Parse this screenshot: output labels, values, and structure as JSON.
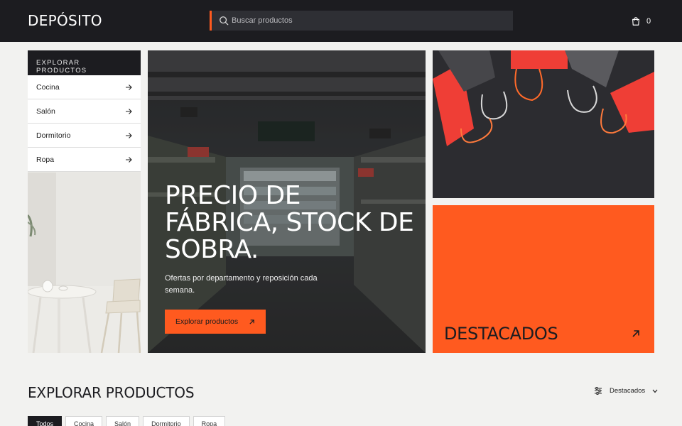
{
  "header": {
    "logo": "DEPÓSITO",
    "search_placeholder": "Buscar productos",
    "cart_count": "0"
  },
  "categories": {
    "title": "EXPLORAR PRODUCTOS",
    "items": [
      {
        "label": "Cocina"
      },
      {
        "label": "Salón"
      },
      {
        "label": "Dormitorio"
      },
      {
        "label": "Ropa"
      }
    ]
  },
  "hero": {
    "title": "PRECIO DE FÁBRICA, STOCK DE SOBRA.",
    "subtitle": "Ofertas por departamento y reposición cada semana.",
    "button": "Explorar productos"
  },
  "featured": {
    "label": "DESTACADOS"
  },
  "section": {
    "title": "EXPLORAR PRODUCTOS",
    "sort_label": "Destacados",
    "filters": [
      {
        "label": "Todos",
        "active": true
      },
      {
        "label": "Cocina",
        "active": false
      },
      {
        "label": "Salón",
        "active": false
      },
      {
        "label": "Dormitorio",
        "active": false
      },
      {
        "label": "Ropa",
        "active": false
      }
    ]
  },
  "colors": {
    "accent": "#ff5a1f",
    "dark": "#1c1c20",
    "background": "#f2f2f0"
  }
}
